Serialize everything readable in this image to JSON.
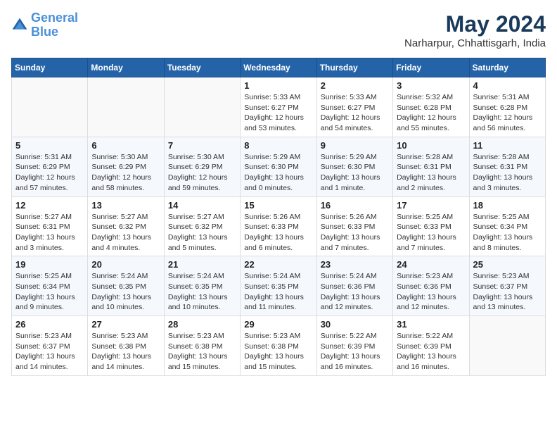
{
  "header": {
    "logo_line1": "General",
    "logo_line2": "Blue",
    "month_year": "May 2024",
    "location": "Narharpur, Chhattisgarh, India"
  },
  "weekdays": [
    "Sunday",
    "Monday",
    "Tuesday",
    "Wednesday",
    "Thursday",
    "Friday",
    "Saturday"
  ],
  "weeks": [
    [
      {
        "day": "",
        "info": ""
      },
      {
        "day": "",
        "info": ""
      },
      {
        "day": "",
        "info": ""
      },
      {
        "day": "1",
        "info": "Sunrise: 5:33 AM\nSunset: 6:27 PM\nDaylight: 12 hours\nand 53 minutes."
      },
      {
        "day": "2",
        "info": "Sunrise: 5:33 AM\nSunset: 6:27 PM\nDaylight: 12 hours\nand 54 minutes."
      },
      {
        "day": "3",
        "info": "Sunrise: 5:32 AM\nSunset: 6:28 PM\nDaylight: 12 hours\nand 55 minutes."
      },
      {
        "day": "4",
        "info": "Sunrise: 5:31 AM\nSunset: 6:28 PM\nDaylight: 12 hours\nand 56 minutes."
      }
    ],
    [
      {
        "day": "5",
        "info": "Sunrise: 5:31 AM\nSunset: 6:29 PM\nDaylight: 12 hours\nand 57 minutes."
      },
      {
        "day": "6",
        "info": "Sunrise: 5:30 AM\nSunset: 6:29 PM\nDaylight: 12 hours\nand 58 minutes."
      },
      {
        "day": "7",
        "info": "Sunrise: 5:30 AM\nSunset: 6:29 PM\nDaylight: 12 hours\nand 59 minutes."
      },
      {
        "day": "8",
        "info": "Sunrise: 5:29 AM\nSunset: 6:30 PM\nDaylight: 13 hours\nand 0 minutes."
      },
      {
        "day": "9",
        "info": "Sunrise: 5:29 AM\nSunset: 6:30 PM\nDaylight: 13 hours\nand 1 minute."
      },
      {
        "day": "10",
        "info": "Sunrise: 5:28 AM\nSunset: 6:31 PM\nDaylight: 13 hours\nand 2 minutes."
      },
      {
        "day": "11",
        "info": "Sunrise: 5:28 AM\nSunset: 6:31 PM\nDaylight: 13 hours\nand 3 minutes."
      }
    ],
    [
      {
        "day": "12",
        "info": "Sunrise: 5:27 AM\nSunset: 6:31 PM\nDaylight: 13 hours\nand 3 minutes."
      },
      {
        "day": "13",
        "info": "Sunrise: 5:27 AM\nSunset: 6:32 PM\nDaylight: 13 hours\nand 4 minutes."
      },
      {
        "day": "14",
        "info": "Sunrise: 5:27 AM\nSunset: 6:32 PM\nDaylight: 13 hours\nand 5 minutes."
      },
      {
        "day": "15",
        "info": "Sunrise: 5:26 AM\nSunset: 6:33 PM\nDaylight: 13 hours\nand 6 minutes."
      },
      {
        "day": "16",
        "info": "Sunrise: 5:26 AM\nSunset: 6:33 PM\nDaylight: 13 hours\nand 7 minutes."
      },
      {
        "day": "17",
        "info": "Sunrise: 5:25 AM\nSunset: 6:33 PM\nDaylight: 13 hours\nand 7 minutes."
      },
      {
        "day": "18",
        "info": "Sunrise: 5:25 AM\nSunset: 6:34 PM\nDaylight: 13 hours\nand 8 minutes."
      }
    ],
    [
      {
        "day": "19",
        "info": "Sunrise: 5:25 AM\nSunset: 6:34 PM\nDaylight: 13 hours\nand 9 minutes."
      },
      {
        "day": "20",
        "info": "Sunrise: 5:24 AM\nSunset: 6:35 PM\nDaylight: 13 hours\nand 10 minutes."
      },
      {
        "day": "21",
        "info": "Sunrise: 5:24 AM\nSunset: 6:35 PM\nDaylight: 13 hours\nand 10 minutes."
      },
      {
        "day": "22",
        "info": "Sunrise: 5:24 AM\nSunset: 6:35 PM\nDaylight: 13 hours\nand 11 minutes."
      },
      {
        "day": "23",
        "info": "Sunrise: 5:24 AM\nSunset: 6:36 PM\nDaylight: 13 hours\nand 12 minutes."
      },
      {
        "day": "24",
        "info": "Sunrise: 5:23 AM\nSunset: 6:36 PM\nDaylight: 13 hours\nand 12 minutes."
      },
      {
        "day": "25",
        "info": "Sunrise: 5:23 AM\nSunset: 6:37 PM\nDaylight: 13 hours\nand 13 minutes."
      }
    ],
    [
      {
        "day": "26",
        "info": "Sunrise: 5:23 AM\nSunset: 6:37 PM\nDaylight: 13 hours\nand 14 minutes."
      },
      {
        "day": "27",
        "info": "Sunrise: 5:23 AM\nSunset: 6:38 PM\nDaylight: 13 hours\nand 14 minutes."
      },
      {
        "day": "28",
        "info": "Sunrise: 5:23 AM\nSunset: 6:38 PM\nDaylight: 13 hours\nand 15 minutes."
      },
      {
        "day": "29",
        "info": "Sunrise: 5:23 AM\nSunset: 6:38 PM\nDaylight: 13 hours\nand 15 minutes."
      },
      {
        "day": "30",
        "info": "Sunrise: 5:22 AM\nSunset: 6:39 PM\nDaylight: 13 hours\nand 16 minutes."
      },
      {
        "day": "31",
        "info": "Sunrise: 5:22 AM\nSunset: 6:39 PM\nDaylight: 13 hours\nand 16 minutes."
      },
      {
        "day": "",
        "info": ""
      }
    ]
  ]
}
